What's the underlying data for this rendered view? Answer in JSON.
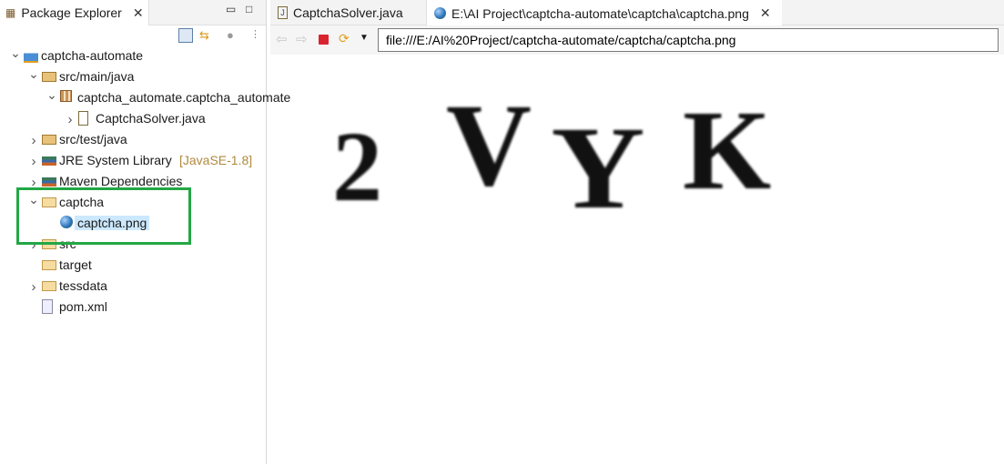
{
  "explorer": {
    "title": "Package Explorer",
    "tree": [
      {
        "label": "captcha-automate",
        "level": 0,
        "expanded": true,
        "icon": "maven-project-icon"
      },
      {
        "label": "src/main/java",
        "level": 1,
        "expanded": true,
        "icon": "source-folder-icon"
      },
      {
        "label": "captcha_automate.captcha_automate",
        "level": 2,
        "expanded": true,
        "icon": "package-icon"
      },
      {
        "label": "CaptchaSolver.java",
        "level": 3,
        "expanded": false,
        "icon": "java-file-icon"
      },
      {
        "label": "src/test/java",
        "level": 1,
        "expanded": false,
        "icon": "source-folder-icon"
      },
      {
        "label": "JRE System Library",
        "suffix": "[JavaSE-1.8]",
        "level": 1,
        "expanded": false,
        "icon": "library-icon"
      },
      {
        "label": "Maven Dependencies",
        "level": 1,
        "expanded": false,
        "icon": "library-icon"
      },
      {
        "label": "captcha",
        "level": 1,
        "expanded": true,
        "icon": "folder-icon"
      },
      {
        "label": "captcha.png",
        "level": 2,
        "selected": true,
        "icon": "image-file-icon"
      },
      {
        "label": "src",
        "level": 1,
        "expanded": false,
        "icon": "folder-icon"
      },
      {
        "label": "target",
        "level": 1,
        "icon": "folder-icon"
      },
      {
        "label": "tessdata",
        "level": 1,
        "expanded": false,
        "icon": "folder-icon"
      },
      {
        "label": "pom.xml",
        "level": 1,
        "icon": "maven-pom-icon"
      }
    ]
  },
  "editor": {
    "tabs": [
      {
        "label": "CaptchaSolver.java",
        "active": false
      },
      {
        "label": "E:\\AI Project\\captcha-automate\\captcha\\captcha.png",
        "active": true
      }
    ],
    "url": "file:///E:/AI%20Project/captcha-automate/captcha/captcha.png",
    "captcha_text": [
      "2",
      "V",
      "Y",
      "K"
    ]
  },
  "colors": {
    "highlight": "#23a745",
    "selection": "#cce8ff",
    "suffix": "#b08a3e"
  }
}
